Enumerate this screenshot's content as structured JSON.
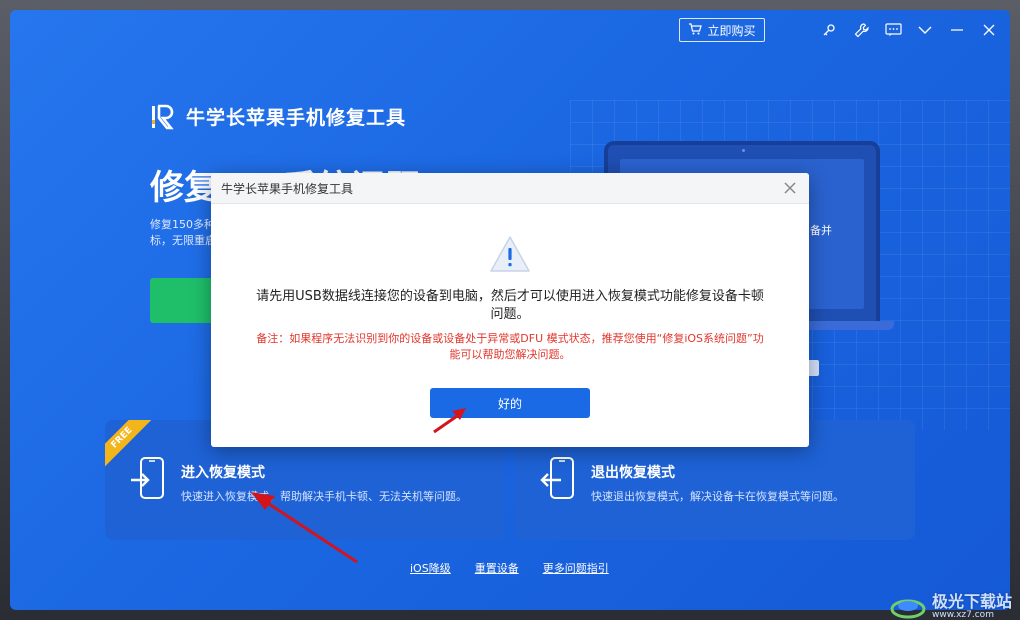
{
  "topbar": {
    "buy_label": "立即购买"
  },
  "app": {
    "name": "牛学长苹果手机修复工具"
  },
  "hero": {
    "title": "修复iOS系统问题",
    "desc": "修复150多种iOS系统问题，如卡在苹果图标，无限重启，黑屏等"
  },
  "laptop": {
    "side_text": "备并"
  },
  "cards": [
    {
      "title": "进入恢复模式",
      "desc": "快速进入恢复模式，帮助解决手机卡顿、无法关机等问题。",
      "badge": "FREE"
    },
    {
      "title": "退出恢复模式",
      "desc": "快速退出恢复模式，解决设备卡在恢复模式等问题。"
    }
  ],
  "bottom_links": [
    "iOS降级",
    "重置设备",
    "更多问题指引"
  ],
  "dialog": {
    "title": "牛学长苹果手机修复工具",
    "message": "请先用USB数据线连接您的设备到电脑，然后才可以使用进入恢复模式功能修复设备卡顿问题。",
    "note": "备注：如果程序无法识别到你的设备或设备处于异常或DFU 模式状态，推荐您使用“修复iOS系统问题”功能可以帮助您解决问题。",
    "ok_label": "好的"
  },
  "watermark": {
    "text": "极光下载站",
    "sub": "www.xz7.com"
  },
  "colors": {
    "app_bg": "#1b67e2",
    "ok_button": "#1a6ae6",
    "note_red": "#e2362c",
    "hero_green": "#1fbf6a",
    "free_badge": "#f2b51c"
  }
}
